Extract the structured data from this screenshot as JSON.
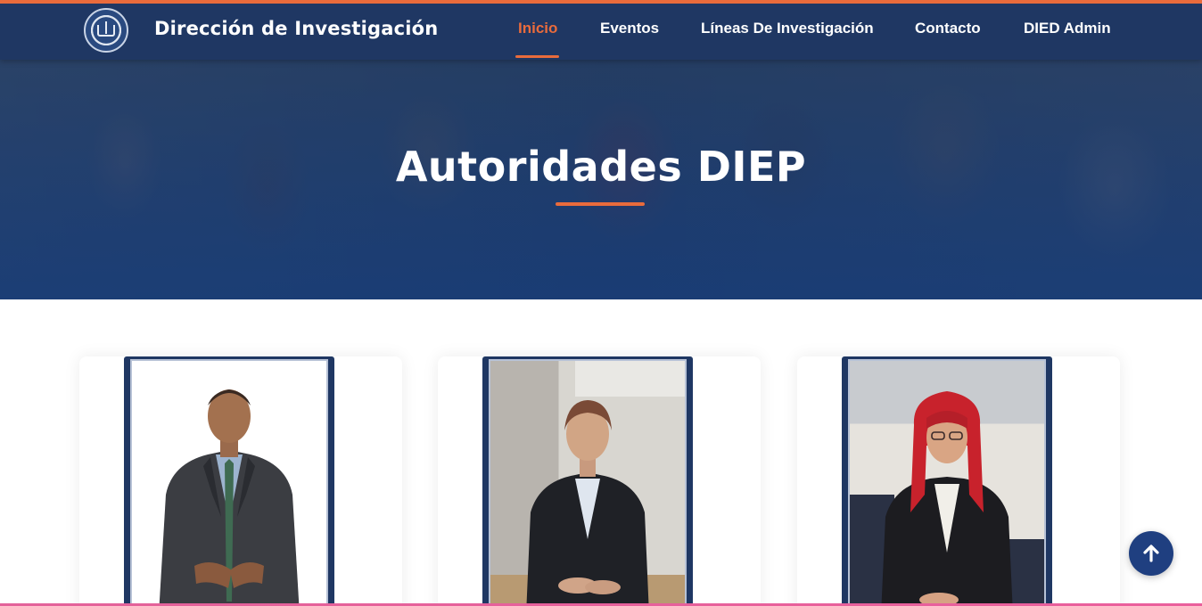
{
  "header": {
    "brand": "Dirección de Investigación",
    "nav": [
      {
        "label": "Inicio",
        "active": true
      },
      {
        "label": "Eventos",
        "active": false
      },
      {
        "label": "Líneas De Investigación",
        "active": false
      },
      {
        "label": "Contacto",
        "active": false
      },
      {
        "label": "DIED Admin",
        "active": false
      }
    ],
    "logo_icon": "book-seal-icon"
  },
  "hero": {
    "title": "Autoridades DIEP"
  },
  "cards": [
    {
      "photo": "man-in-suit-portrait"
    },
    {
      "photo": "woman-seated-portrait"
    },
    {
      "photo": "woman-red-hair-portrait"
    }
  ],
  "scroll_top_icon": "arrow-up-icon",
  "colors": {
    "primary": "#1f3763",
    "accent": "#e96b3c",
    "hero_blue": "#19407a"
  }
}
